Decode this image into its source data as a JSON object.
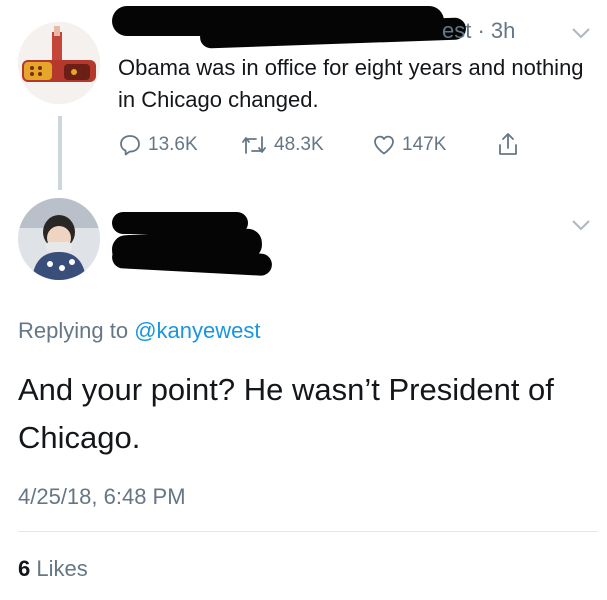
{
  "tweet1": {
    "time_suffix": "est · 3h",
    "text": "Obama was in office for eight years and nothing in Chicago changed.",
    "actions": {
      "replies": "13.6K",
      "retweets": "48.3K",
      "likes": "147K"
    }
  },
  "tweet2": {
    "replying_prefix": "Replying to ",
    "replying_handle": "@kanyewest",
    "text": "And your point? He wasn’t President of Chicago.",
    "timestamp": "4/25/18, 6:48 PM",
    "likes_count": "6",
    "likes_label": " Likes"
  },
  "icons": {
    "reply": "reply-icon",
    "retweet": "retweet-icon",
    "like": "heart-icon",
    "share": "share-icon",
    "more": "chevron-down-icon"
  },
  "colors": {
    "secondary_text": "#657786",
    "link": "#1b95e0",
    "primary_text": "#14171a",
    "redaction": "#050505"
  }
}
